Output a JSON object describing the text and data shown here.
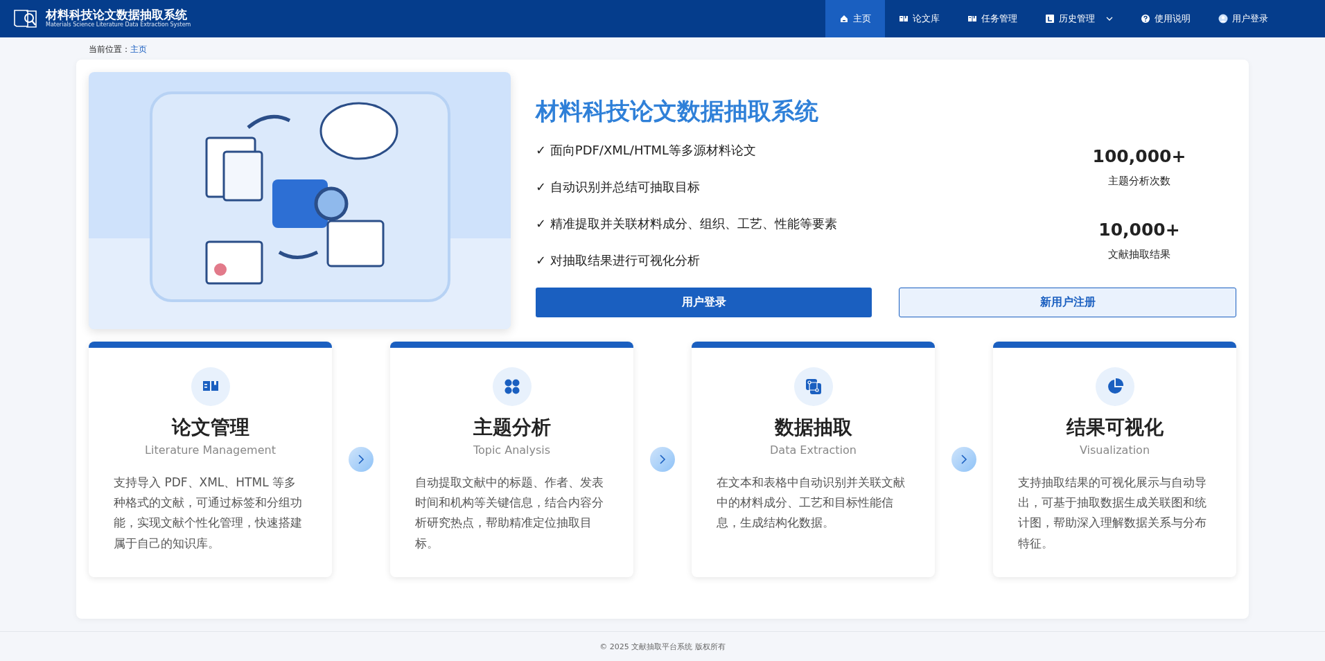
{
  "brand": {
    "title": "材料科技论文数据抽取系统",
    "subtitle": "Materials Science Literature Data Extraction System"
  },
  "nav": [
    {
      "label": "主页",
      "kind": "home",
      "selected": true
    },
    {
      "label": "论文库",
      "kind": "library",
      "selected": false
    },
    {
      "label": "任务管理",
      "kind": "tasks",
      "selected": false
    },
    {
      "label": "历史管理",
      "kind": "history",
      "selected": false,
      "dropdown": true
    },
    {
      "label": "使用说明",
      "kind": "help",
      "selected": false
    },
    {
      "label": "用户登录",
      "kind": "user",
      "selected": false
    }
  ],
  "breadcrumb": {
    "label": "当前位置：",
    "current": "主页"
  },
  "hero": {
    "title": "材料科技论文数据抽取系统",
    "features": [
      {
        "mark": "✓",
        "text": "面向PDF/XML/HTML等多源材料论文"
      },
      {
        "mark": "✓",
        "text": "自动识别并总结可抽取目标"
      },
      {
        "mark": "✓",
        "text": "精准提取并关联材料成分、组织、工艺、性能等要素"
      },
      {
        "mark": "✓",
        "text": "对抽取结果进行可视化分析"
      }
    ],
    "stats": [
      {
        "value": "100,000+",
        "label": "主题分析次数"
      },
      {
        "value": "10,000+",
        "label": "文献抽取结果"
      }
    ],
    "buttons": [
      {
        "label": "用户登录",
        "kind": "primary"
      },
      {
        "label": "新用户注册",
        "kind": "outline"
      }
    ]
  },
  "cards": [
    {
      "kind": "literature",
      "title": "论文管理",
      "subtitle": "Literature Management",
      "text": "支持导入 PDF、XML、HTML 等多种格式的文献，可通过标签和分组功能，实现文献个性化管理，快速搭建属于自己的知识库。"
    },
    {
      "kind": "topic",
      "title": "主题分析",
      "subtitle": "Topic Analysis",
      "text": "自动提取文献中的标题、作者、发表时间和机构等关键信息，结合内容分析研究热点，帮助精准定位抽取目标。"
    },
    {
      "kind": "extraction",
      "title": "数据抽取",
      "subtitle": "Data Extraction",
      "text": "在文本和表格中自动识别并关联文献中的材料成分、工艺和目标性能信息，生成结构化数据。"
    },
    {
      "kind": "visualization",
      "title": "结果可视化",
      "subtitle": "Visualization",
      "text": "支持抽取结果的可视化展示与自动导出，可基于抽取数据生成关联图和统计图，帮助深入理解数据关系与分布特征。"
    }
  ],
  "footer": "© 2025 文献抽取平台系统 版权所有"
}
